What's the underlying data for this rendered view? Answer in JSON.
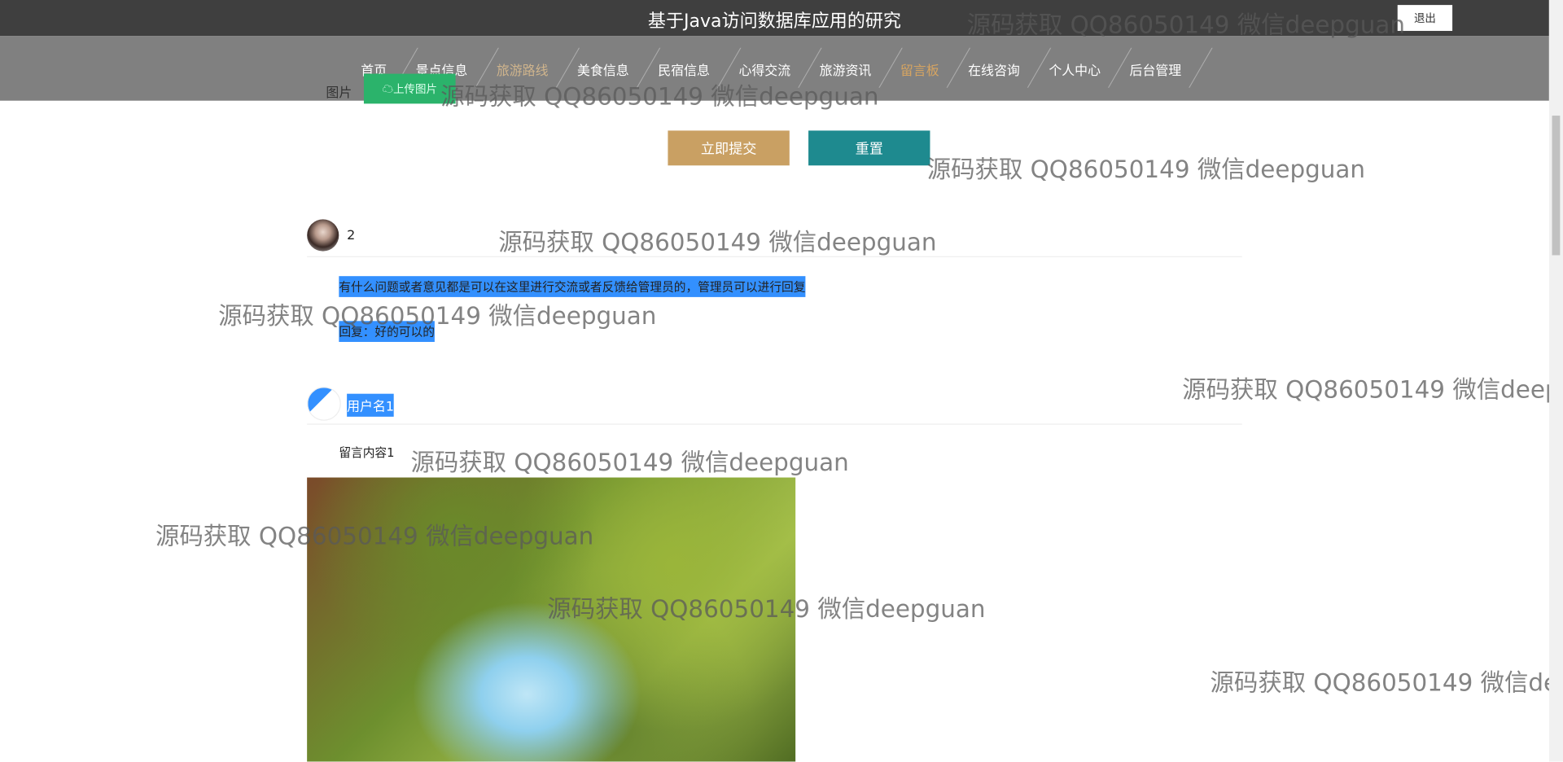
{
  "header": {
    "title": "基于Java访问数据库应用的研究",
    "logout": "退出"
  },
  "nav": [
    {
      "label": "首页"
    },
    {
      "label": "景点信息"
    },
    {
      "label": "旅游路线"
    },
    {
      "label": "美食信息"
    },
    {
      "label": "民宿信息"
    },
    {
      "label": "心得交流"
    },
    {
      "label": "旅游资讯"
    },
    {
      "label": "留言板"
    },
    {
      "label": "在线咨询"
    },
    {
      "label": "个人中心"
    },
    {
      "label": "后台管理"
    }
  ],
  "form": {
    "image_label": "图片",
    "upload": "上传图片",
    "submit": "立即提交",
    "reset": "重置"
  },
  "messages": [
    {
      "user": "2",
      "content": "有什么问题或者意见都是可以在这里进行交流或者反馈给管理员的，管理员可以进行回复",
      "reply": "回复：好的可以的"
    },
    {
      "user": "用户名1",
      "content": "留言内容1"
    }
  ],
  "watermark": "源码获取 QQ86050149 微信deepguan"
}
